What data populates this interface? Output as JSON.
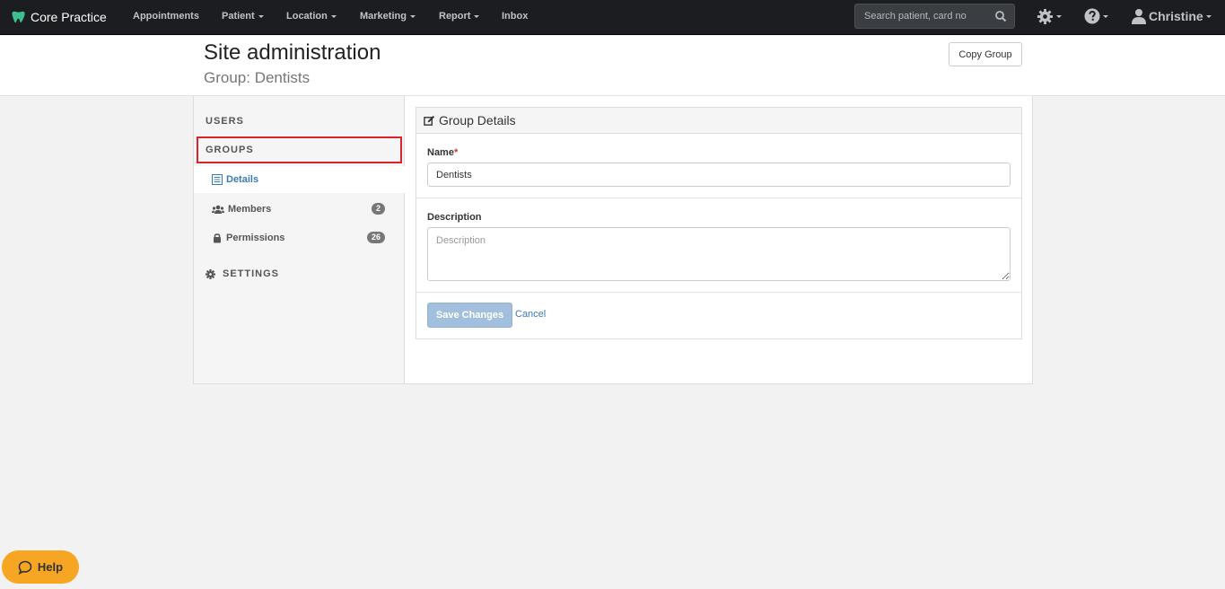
{
  "nav": {
    "brand": "Core Practice",
    "items": [
      {
        "label": "Appointments",
        "dropdown": false
      },
      {
        "label": "Patient",
        "dropdown": true
      },
      {
        "label": "Location",
        "dropdown": true
      },
      {
        "label": "Marketing",
        "dropdown": true
      },
      {
        "label": "Report",
        "dropdown": true
      },
      {
        "label": "Inbox",
        "dropdown": false
      }
    ],
    "search_placeholder": "Search patient, card no",
    "user_name": "Christine"
  },
  "header": {
    "title": "Site administration",
    "subtitle": "Group: Dentists",
    "copy_button": "Copy Group"
  },
  "sidebar": {
    "users": "USERS",
    "groups": "GROUPS",
    "sub_items": [
      {
        "label": "Details",
        "icon": "list-icon",
        "badge": null
      },
      {
        "label": "Members",
        "icon": "users-icon",
        "badge": "2"
      },
      {
        "label": "Permissions",
        "icon": "lock-icon",
        "badge": "26"
      }
    ],
    "settings": "SETTINGS"
  },
  "panel": {
    "title": "Group Details",
    "name_label": "Name",
    "name_required": "*",
    "name_value": "Dentists",
    "description_label": "Description",
    "description_placeholder": "Description",
    "save_button": "Save Changes",
    "cancel_link": "Cancel"
  },
  "help": {
    "label": "Help"
  },
  "colors": {
    "nav_bg": "#1b1d21",
    "brand_green": "#3ebf8f",
    "link_blue": "#3a7ab5",
    "highlight_red": "#d9252a",
    "help_orange": "#f6a623"
  }
}
